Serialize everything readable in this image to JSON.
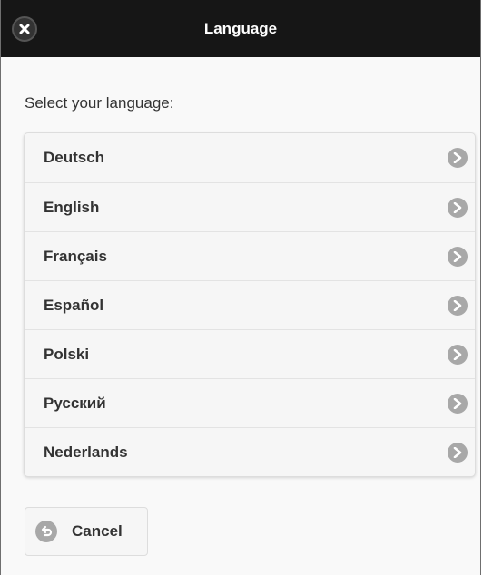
{
  "header": {
    "title": "Language",
    "close_icon": "close-icon"
  },
  "prompt": "Select your language:",
  "languages": [
    {
      "label": "Deutsch"
    },
    {
      "label": "English"
    },
    {
      "label": "Français"
    },
    {
      "label": "Español"
    },
    {
      "label": "Polski"
    },
    {
      "label": "Русский"
    },
    {
      "label": "Nederlands"
    }
  ],
  "cancel": {
    "label": "Cancel",
    "icon": "back-icon"
  },
  "colors": {
    "header_bg": "#161616",
    "page_bg": "#f9f9f9",
    "list_bg": "#f6f6f6",
    "icon_bg": "#a8a8a8",
    "text": "#333333"
  }
}
